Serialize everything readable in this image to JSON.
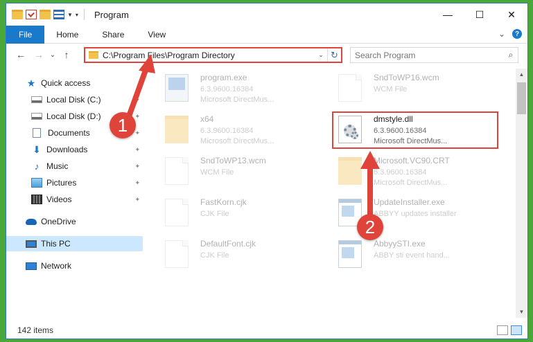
{
  "window": {
    "title": "Program",
    "controls": {
      "minimize": "—",
      "maximize": "☐",
      "close": "✕"
    }
  },
  "ribbon": {
    "tabs": [
      "File",
      "Home",
      "Share",
      "View"
    ],
    "expand_glyph": "⌄",
    "help_glyph": "?"
  },
  "nav_buttons": {
    "back": "←",
    "forward": "→",
    "recent": "⌄",
    "up": "↑"
  },
  "address": {
    "path": "C:\\Program Files\\Program Directory",
    "dropdown_glyph": "⌄",
    "refresh_glyph": "↻"
  },
  "search": {
    "placeholder": "Search Program",
    "icon": "🔍"
  },
  "sidebar": {
    "items": [
      {
        "label": "Quick access",
        "icon": "star-icon"
      },
      {
        "label": "Local Disk (C:)",
        "icon": "drive-icon",
        "pinned": true
      },
      {
        "label": "Local Disk (D:)",
        "icon": "drive-icon",
        "pinned": true
      },
      {
        "label": "Documents",
        "icon": "documents-icon",
        "pinned": true
      },
      {
        "label": "Downloads",
        "icon": "download-icon",
        "pinned": true
      },
      {
        "label": "Music",
        "icon": "music-icon",
        "pinned": true
      },
      {
        "label": "Pictures",
        "icon": "pictures-icon",
        "pinned": true
      },
      {
        "label": "Videos",
        "icon": "videos-icon",
        "pinned": true
      },
      {
        "label": "OneDrive",
        "icon": "onedrive-icon"
      },
      {
        "label": "This PC",
        "icon": "pc-icon",
        "selected": true
      },
      {
        "label": "Network",
        "icon": "network-icon"
      }
    ],
    "pin_glyph": "📌"
  },
  "files": [
    {
      "name": "program.exe",
      "line2": "6.3.9600.16384",
      "line3": "Microsoft DirectMus...",
      "icon": "exe-icon"
    },
    {
      "name": "SndToWP16.wcm",
      "line2": "WCM File",
      "line3": "",
      "icon": "document-icon"
    },
    {
      "name": "x64",
      "line2": "6.3.9600.16384",
      "line3": "Microsoft DirectMus...",
      "icon": "folder-icon"
    },
    {
      "name": "dmstyle.dll",
      "line2": "6.3.9600.16384",
      "line3": "Microsoft DirectMus...",
      "icon": "dll-icon"
    },
    {
      "name": "SndToWP13.wcm",
      "line2": "WCM File",
      "line3": "",
      "icon": "document-icon"
    },
    {
      "name": "Microsoft.VC90.CRT",
      "line2": "6.3.9600.16384",
      "line3": "Microsoft DirectMus...",
      "icon": "folder-icon"
    },
    {
      "name": "FastKorn.cjk",
      "line2": "CJK File",
      "line3": "",
      "icon": "document-icon"
    },
    {
      "name": "UpdateInstaller.exe",
      "line2": "ABBYY updates installer",
      "line3": "",
      "icon": "app-icon"
    },
    {
      "name": "DefaultFont.cjk",
      "line2": "CJK File",
      "line3": "",
      "icon": "document-icon"
    },
    {
      "name": "AbbyySTI.exe",
      "line2": "ABBY sti event hand...",
      "line3": "",
      "icon": "app-icon"
    }
  ],
  "status": {
    "count": "142 items"
  },
  "annotations": [
    {
      "label": "1"
    },
    {
      "label": "2"
    }
  ],
  "colors": {
    "accent": "#1979ca",
    "highlight": "#e0433a",
    "background": "#4aa83a"
  }
}
